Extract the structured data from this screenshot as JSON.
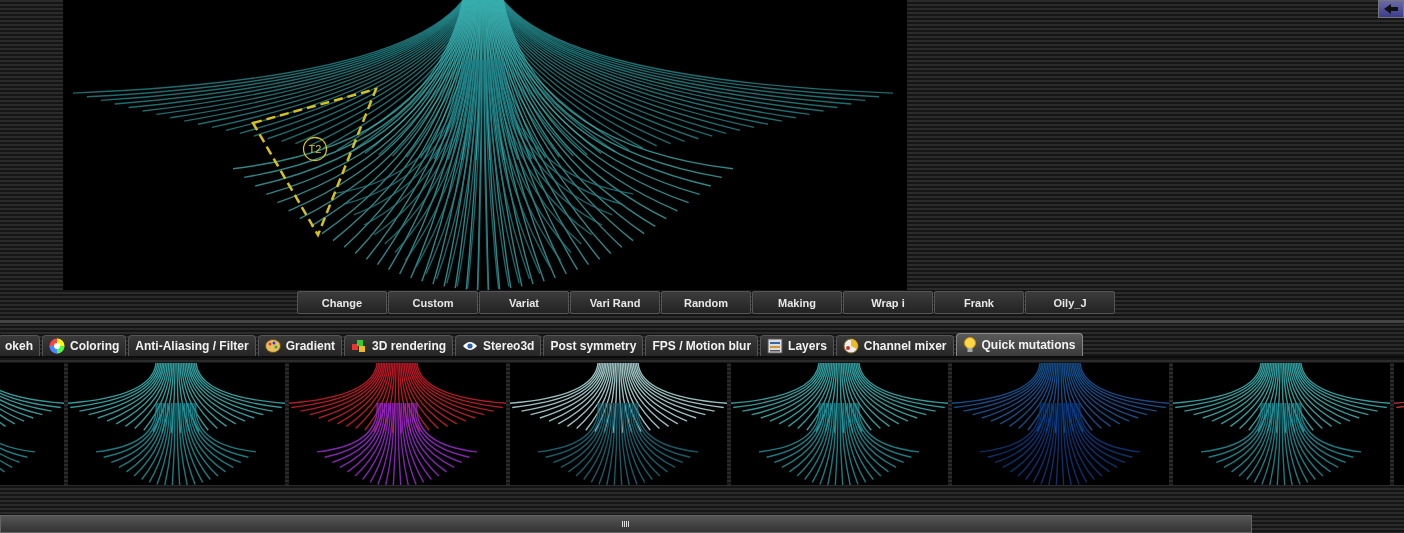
{
  "preview": {
    "transform_label": "T2"
  },
  "mutation_buttons": [
    "Change",
    "Custom",
    "Variat",
    "Vari Rand",
    "Random",
    "Making",
    "Wrap i",
    "Frank",
    "Oily_J"
  ],
  "tabs": [
    {
      "label": "okeh",
      "selected": false
    },
    {
      "label": "Coloring",
      "selected": false
    },
    {
      "label": "Anti-Aliasing / Filter",
      "selected": false
    },
    {
      "label": "Gradient",
      "selected": false
    },
    {
      "label": "3D rendering",
      "selected": false
    },
    {
      "label": "Stereo3d",
      "selected": false
    },
    {
      "label": "Post symmetry",
      "selected": false
    },
    {
      "label": "FPS / Motion blur",
      "selected": false
    },
    {
      "label": "Layers",
      "selected": false
    },
    {
      "label": "Channel mixer",
      "selected": false
    },
    {
      "label": "Quick mutations",
      "selected": true
    }
  ],
  "thumbnails": [
    {
      "kind": "teal"
    },
    {
      "kind": "teal"
    },
    {
      "kind": "redviolet"
    },
    {
      "kind": "pale"
    },
    {
      "kind": "teal"
    },
    {
      "kind": "blue"
    },
    {
      "kind": "teal"
    },
    {
      "kind": "red"
    }
  ]
}
